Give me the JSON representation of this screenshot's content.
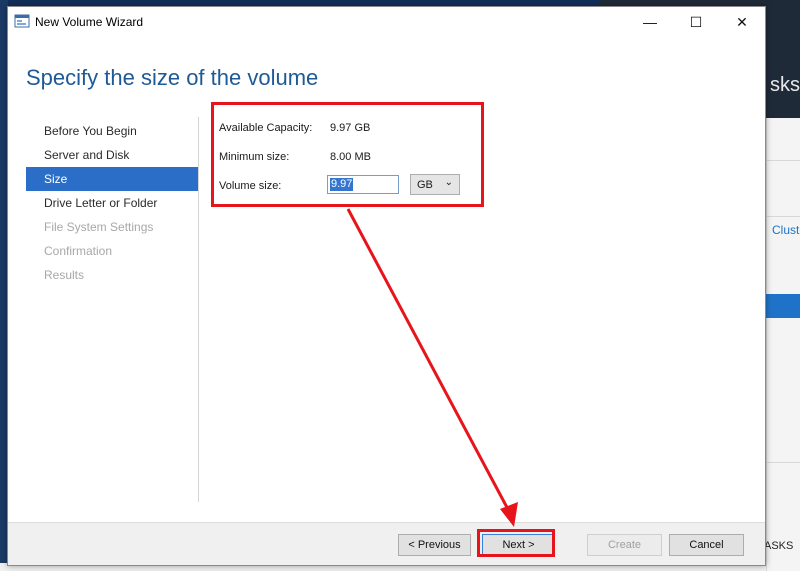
{
  "background": {
    "header_text": "sks",
    "link_text": "Cluste",
    "tasks_text": "ASKS"
  },
  "window": {
    "title": "New Volume Wizard",
    "controls": {
      "minimize": "—",
      "maximize": "☐",
      "close": "✕"
    }
  },
  "heading": "Specify the size of the volume",
  "nav": {
    "items": [
      {
        "label": "Before You Begin"
      },
      {
        "label": "Server and Disk"
      },
      {
        "label": "Size"
      },
      {
        "label": "Drive Letter or Folder"
      },
      {
        "label": "File System Settings"
      },
      {
        "label": "Confirmation"
      },
      {
        "label": "Results"
      }
    ],
    "active": "Size"
  },
  "form": {
    "available_capacity_label": "Available Capacity:",
    "available_capacity_value": "9.97 GB",
    "minimum_size_label": "Minimum size:",
    "minimum_size_value": "8.00 MB",
    "volume_size_label": "Volume size:",
    "volume_size_value": "9.97",
    "unit": "GB"
  },
  "buttons": {
    "previous": "< Previous",
    "next": "Next >",
    "create": "Create",
    "cancel": "Cancel"
  },
  "colors": {
    "accent": "#2a6ec8",
    "heading": "#1e5a96",
    "annotation": "#e8141c"
  }
}
